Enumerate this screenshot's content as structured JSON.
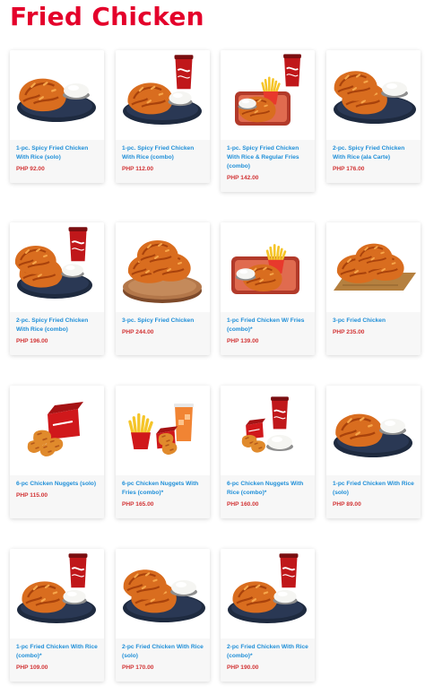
{
  "page": {
    "title": "Fried Chicken"
  },
  "colors": {
    "title": "#e4002b",
    "name": "#1f8fd8",
    "price": "#d23536"
  },
  "items": [
    {
      "name": "1-pc. Spicy Fried Chicken With Rice (solo)",
      "price": "PHP 92.00",
      "image": "chicken-rice-plate"
    },
    {
      "name": "1-pc. Spicy Fried Chicken With Rice (combo)",
      "price": "PHP 112.00",
      "image": "chicken-rice-drink"
    },
    {
      "name": "1-pc. Spicy Fried Chicken With Rice & Regular Fries (combo)",
      "price": "PHP 142.00",
      "image": "chicken-fries-tray-drink"
    },
    {
      "name": "2-pc. Spicy Fried Chicken With Rice (ala Carte)",
      "price": "PHP 176.00",
      "image": "two-chicken-rice-plate"
    },
    {
      "name": "2-pc. Spicy Fried Chicken With Rice (combo)",
      "price": "PHP 196.00",
      "image": "two-chicken-rice-drink"
    },
    {
      "name": "3-pc. Spicy Fried Chicken",
      "price": "PHP 244.00",
      "image": "three-chicken-board"
    },
    {
      "name": "1-pc Fried Chicken W/ Fries (combo)*",
      "price": "PHP 139.00",
      "image": "chicken-fries-tray"
    },
    {
      "name": "3-pc Fried Chicken",
      "price": "PHP 235.00",
      "image": "three-chicken-plank"
    },
    {
      "name": "6-pc Chicken Nuggets (solo)",
      "price": "PHP 115.00",
      "image": "nuggets-box"
    },
    {
      "name": "6-pc Chicken Nuggets With Fries (combo)*",
      "price": "PHP 165.00",
      "image": "nuggets-fries-iced-tea"
    },
    {
      "name": "6-pc Chicken Nuggets With Rice (combo)*",
      "price": "PHP 160.00",
      "image": "nuggets-rice-drink"
    },
    {
      "name": "1-pc Fried Chicken With Rice (solo)",
      "price": "PHP 89.00",
      "image": "chicken-rice-plate"
    },
    {
      "name": "1-pc Fried Chicken With Rice (combo)*",
      "price": "PHP 109.00",
      "image": "chicken-rice-drink"
    },
    {
      "name": "2-pc Fried Chicken With Rice (solo)",
      "price": "PHP 170.00",
      "image": "two-chicken-rice-plate"
    },
    {
      "name": "2-pc Fried Chicken With Rice (combo)*",
      "price": "PHP 190.00",
      "image": "chicken-rice-drink"
    }
  ]
}
